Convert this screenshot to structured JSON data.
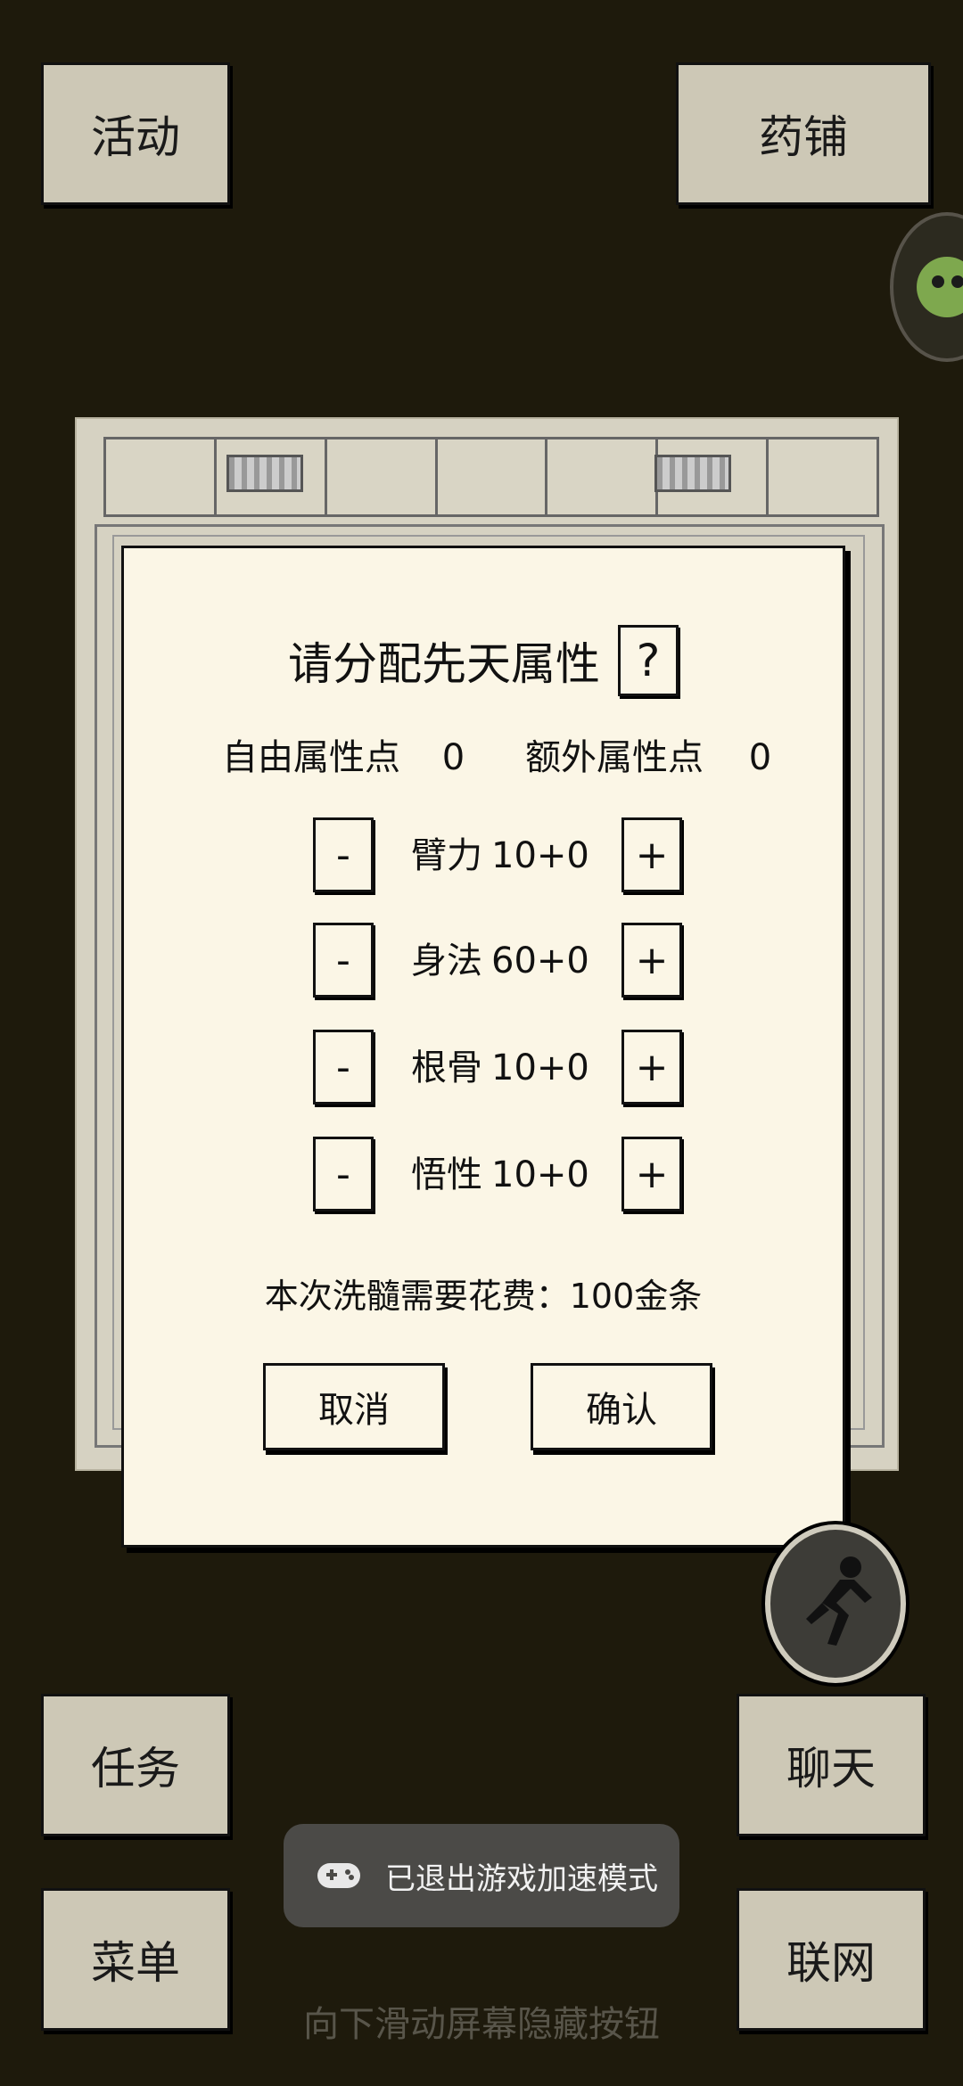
{
  "corner_buttons": {
    "activity": "活动",
    "pharmacy": "药铺",
    "task": "任务",
    "chat": "聊天",
    "menu": "菜单",
    "network": "联网"
  },
  "dialog": {
    "title": "请分配先天属性",
    "help": "?",
    "free_points_label": "自由属性点",
    "free_points_value": "0",
    "extra_points_label": "额外属性点",
    "extra_points_value": "0",
    "minus": "-",
    "plus": "+",
    "stats": [
      {
        "label": "臂力",
        "value": "10+0"
      },
      {
        "label": "身法",
        "value": "60+0"
      },
      {
        "label": "根骨",
        "value": "10+0"
      },
      {
        "label": "悟性",
        "value": "10+0"
      }
    ],
    "cost_text": "本次洗髓需要花费：100金条",
    "cancel": "取消",
    "confirm": "确认"
  },
  "toast": {
    "text": "已退出游戏加速模式",
    "icon": "gamepad-icon"
  },
  "hint": "向下滑动屏幕隐藏按钮",
  "colors": {
    "background": "#1e1a0c",
    "dialog": "#fbf6e6",
    "corner_button": "#cdc8b6"
  }
}
